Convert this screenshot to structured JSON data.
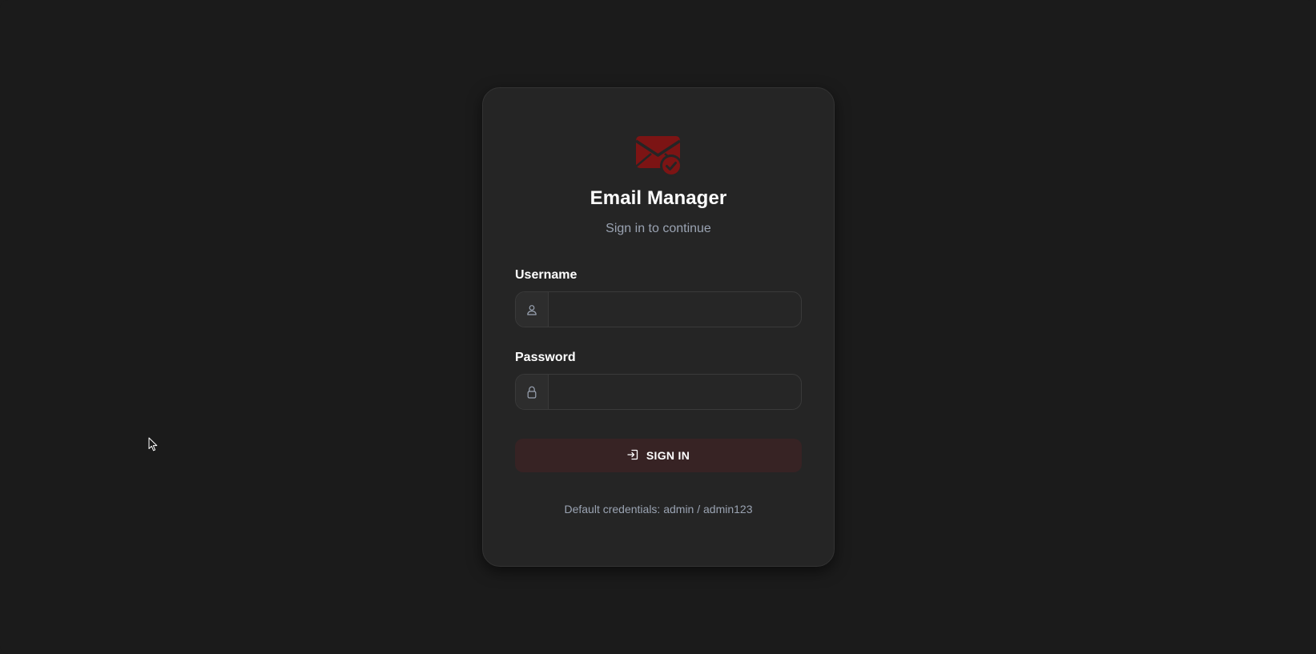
{
  "app": {
    "title": "Email Manager",
    "subtitle": "Sign in to continue",
    "logo_icon": "envelope-check-icon",
    "accent_color": "#8b1a1a"
  },
  "form": {
    "username_label": "Username",
    "username_value": "",
    "username_icon": "user-icon",
    "password_label": "Password",
    "password_value": "",
    "password_icon": "lock-icon",
    "submit_label": "SIGN IN",
    "submit_icon": "sign-in-icon"
  },
  "footer": {
    "hint": "Default credentials: admin / admin123"
  }
}
